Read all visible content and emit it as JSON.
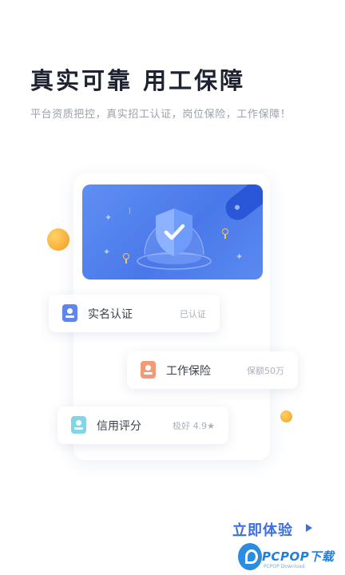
{
  "hero": {
    "title": "真实可靠 用工保障",
    "subtitle": "平台资质把控，真实招工认证，岗位保险，工作保障！"
  },
  "cards": [
    {
      "label": "实名认证",
      "status": "已认证",
      "icon": "id-card-icon",
      "icon_color": "#5f86ee"
    },
    {
      "label": "工作保险",
      "status": "保额50万",
      "icon": "insurance-icon",
      "icon_color": "#f29a76"
    },
    {
      "label": "信用评分",
      "status": "极好 4.9★",
      "icon": "credit-badge-icon",
      "icon_color": "#7fd6e8"
    }
  ],
  "cta": {
    "label": "立即体验"
  },
  "watermark": {
    "name": "PCPOP下载",
    "sub": "PCPOP Download"
  },
  "colors": {
    "accent": "#3d6fe0",
    "banner": "#5a88f0",
    "ball_orange": "#f7a928"
  }
}
